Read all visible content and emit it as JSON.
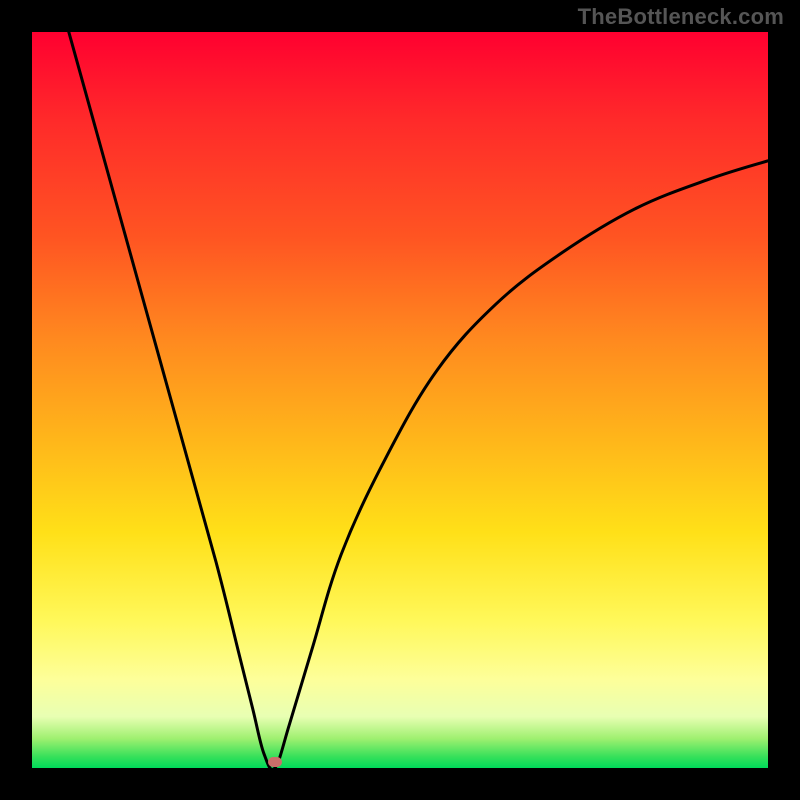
{
  "watermark": "TheBottleneck.com",
  "chart_data": {
    "type": "line",
    "title": "",
    "xlabel": "",
    "ylabel": "",
    "xlim": [
      0,
      100
    ],
    "ylim": [
      0,
      100
    ],
    "grid": false,
    "legend": false,
    "series": [
      {
        "name": "bottleneck-curve",
        "x": [
          5,
          10,
          15,
          20,
          25,
          28,
          30,
          31.5,
          33,
          35,
          38,
          42,
          48,
          55,
          63,
          72,
          82,
          92,
          100
        ],
        "y": [
          100,
          82,
          64,
          46,
          28,
          16,
          8,
          2,
          0,
          6,
          16,
          29,
          42,
          54,
          63,
          70,
          76,
          80,
          82.5
        ]
      }
    ],
    "annotations": [
      {
        "name": "min-marker",
        "x": 33,
        "y": 0.8,
        "shape": "pill",
        "color": "#cc6e6a"
      }
    ],
    "colors": {
      "curve": "#000000",
      "background_gradient": [
        "#ff0030",
        "#ff8a1f",
        "#fff85a",
        "#00da5a"
      ],
      "frame": "#000000"
    }
  }
}
